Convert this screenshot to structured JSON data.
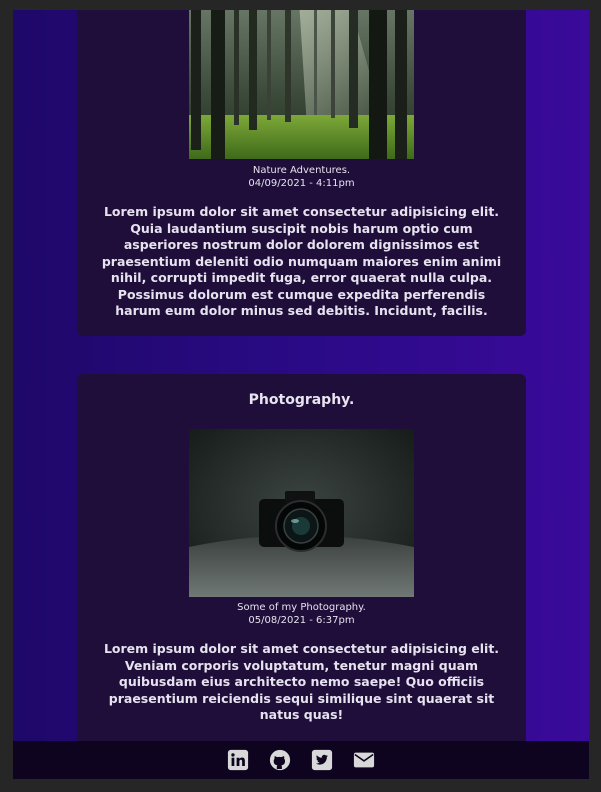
{
  "posts": [
    {
      "title": "",
      "image_alt": "forest-photo",
      "caption": "Nature Adventures.",
      "date": "04/09/2021 - 4:11pm",
      "body": "Lorem ipsum dolor sit amet consectetur adipisicing elit. Quia laudantium suscipit nobis harum optio cum asperiores nostrum dolor dolorem dignissimos est praesentium deleniti odio numquam maiores enim animi nihil, corrupti impedit fuga, error quaerat nulla culpa. Possimus dolorum est cumque expedita perferendis harum eum dolor minus sed debitis. Incidunt, facilis."
    },
    {
      "title": "Photography.",
      "image_alt": "camera-photo",
      "caption": "Some of my Photography.",
      "date": "05/08/2021 - 6:37pm",
      "body": "Lorem ipsum dolor sit amet consectetur adipisicing elit. Veniam corporis voluptatum, tenetur magni quam quibusdam eius architecto nemo saepe! Quo officiis praesentium reiciendis sequi similique sint quaerat sit natus quas!"
    }
  ],
  "footer": {
    "icons": [
      "linkedin-icon",
      "github-icon",
      "twitter-icon",
      "email-icon"
    ]
  },
  "colors": {
    "background": "#262626",
    "accent_purple": "#2a0a86",
    "card": "#1f0e3a",
    "footer": "#0f0420",
    "text": "#e6e2ee"
  }
}
